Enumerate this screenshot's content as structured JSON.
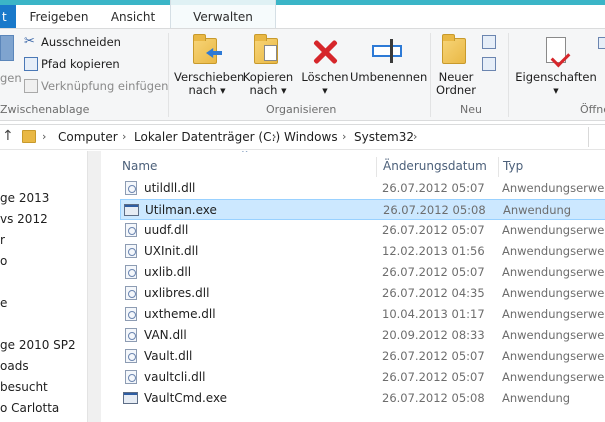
{
  "tabs": {
    "first": "t",
    "share": "Freigeben",
    "view": "Ansicht",
    "manage": "Verwalten"
  },
  "ribbon": {
    "clipboard": {
      "paste_partial": "gen",
      "cut": "Ausschneiden",
      "copy_path": "Pfad kopieren",
      "paste_shortcut": "Verknüpfung einfügen",
      "group_label": "Zwischenablage"
    },
    "organize": {
      "move_to_line1": "Verschieben",
      "move_to_line2": "nach",
      "copy_to_line1": "Kopieren",
      "copy_to_line2": "nach",
      "delete": "Löschen",
      "rename": "Umbenennen",
      "group_label": "Organisieren"
    },
    "new": {
      "new_folder_line1": "Neuer",
      "new_folder_line2": "Ordner",
      "group_label": "Neu"
    },
    "open": {
      "properties": "Eigenschaften",
      "group_label_partial": "Öffne"
    }
  },
  "address": {
    "crumbs": [
      "Computer",
      "Lokaler Datenträger (C:)",
      "Windows",
      "System32"
    ]
  },
  "nav": {
    "items": [
      "ge 2013",
      "vs 2012",
      "r",
      "o",
      "e",
      "ge 2010 SP2",
      "oads",
      "besucht",
      "o Carlotta"
    ]
  },
  "columns": {
    "name": "Name",
    "date": "Änderungsdatum",
    "type": "Typ"
  },
  "files": [
    {
      "name": "utildll.dll",
      "date": "26.07.2012 05:07",
      "type": "Anwendungserwe...",
      "kind": "dll",
      "selected": false
    },
    {
      "name": "Utilman.exe",
      "date": "26.07.2012 05:08",
      "type": "Anwendung",
      "kind": "exe",
      "selected": true
    },
    {
      "name": "uudf.dll",
      "date": "26.07.2012 05:07",
      "type": "Anwendungserwe...",
      "kind": "dll",
      "selected": false
    },
    {
      "name": "UXInit.dll",
      "date": "12.02.2013 01:56",
      "type": "Anwendungserwe...",
      "kind": "dll",
      "selected": false
    },
    {
      "name": "uxlib.dll",
      "date": "26.07.2012 05:07",
      "type": "Anwendungserwe...",
      "kind": "dll",
      "selected": false
    },
    {
      "name": "uxlibres.dll",
      "date": "26.07.2012 04:35",
      "type": "Anwendungserwe...",
      "kind": "dll",
      "selected": false
    },
    {
      "name": "uxtheme.dll",
      "date": "10.04.2013 01:17",
      "type": "Anwendungserwe...",
      "kind": "dll",
      "selected": false
    },
    {
      "name": "VAN.dll",
      "date": "20.09.2012 08:33",
      "type": "Anwendungserwe...",
      "kind": "dll",
      "selected": false
    },
    {
      "name": "Vault.dll",
      "date": "26.07.2012 05:07",
      "type": "Anwendungserwe...",
      "kind": "dll",
      "selected": false
    },
    {
      "name": "vaultcli.dll",
      "date": "26.07.2012 05:07",
      "type": "Anwendungserwe...",
      "kind": "dll",
      "selected": false
    },
    {
      "name": "VaultCmd.exe",
      "date": "26.07.2012 05:08",
      "type": "Anwendung",
      "kind": "exe",
      "selected": false
    }
  ]
}
